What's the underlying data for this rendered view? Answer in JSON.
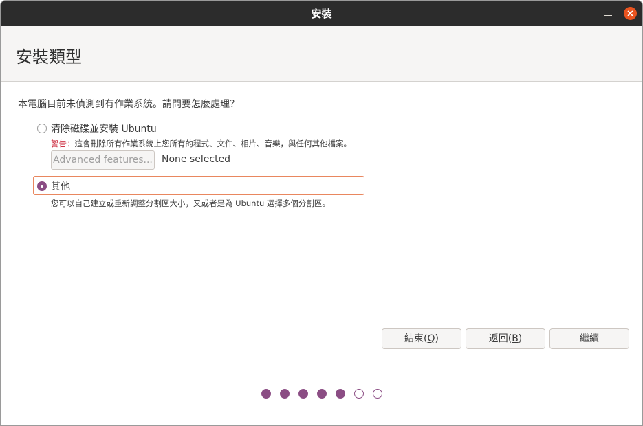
{
  "window": {
    "title": "安裝"
  },
  "header": {
    "title": "安裝類型"
  },
  "content": {
    "question": "本電腦目前未偵測到有作業系統。請問要怎麼處理？",
    "options": [
      {
        "label": "清除磁碟並安裝 Ubuntu",
        "selected": false,
        "warning_prefix": "警告：",
        "warning_text": "這會刪除所有作業系統上您所有的程式、文件、相片、音樂，與任何其他檔案。",
        "advanced_button": "Advanced features...",
        "advanced_status": "None selected"
      },
      {
        "label": "其他",
        "selected": true,
        "description": "您可以自己建立或重新調整分割區大小，又或者是為 Ubuntu 選擇多個分割區。"
      }
    ]
  },
  "buttons": {
    "quit": {
      "text": "結束(",
      "key": "Q",
      "suffix": ")"
    },
    "back": {
      "text": "返回(",
      "key": "B",
      "suffix": ")"
    },
    "continue": "繼續"
  },
  "progress": {
    "total_steps": 7,
    "completed_steps": 5
  },
  "colors": {
    "accent": "#8b4d84",
    "close": "#e95420",
    "focus": "#e9875f",
    "warning": "#c7162b"
  }
}
